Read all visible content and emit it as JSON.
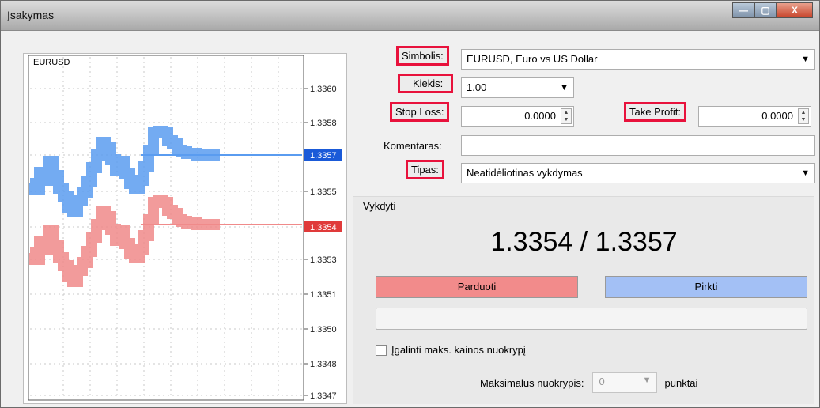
{
  "window": {
    "title": "Įsakymas",
    "buttons": {
      "minimize": "—",
      "maximize": "▢",
      "close": "X"
    }
  },
  "chart": {
    "symbol": "EURUSD",
    "price_ticks": [
      "1.3360",
      "1.3358",
      "1.3357",
      "1.3355",
      "1.3354",
      "1.3353",
      "1.3351",
      "1.3350",
      "1.3348",
      "1.3347"
    ],
    "ask_label": "1.3357",
    "bid_label": "1.3354",
    "colors": {
      "ask": "#5a9cf0",
      "bid": "#f08a8a",
      "ask_tag": "#1a5ad8",
      "bid_tag": "#e03a3a"
    }
  },
  "form": {
    "symbol_label": "Simbolis:",
    "symbol_value": "EURUSD, Euro vs US Dollar",
    "volume_label": "Kiekis:",
    "volume_value": "1.00",
    "stoploss_label": "Stop Loss:",
    "stoploss_value": "0.0000",
    "takeprofit_label": "Take Profit:",
    "takeprofit_value": "0.0000",
    "comment_label": "Komentaras:",
    "comment_value": "",
    "type_label": "Tipas:",
    "type_value": "Neatidėliotinas vykdymas"
  },
  "execution": {
    "group_title": "Vykdyti",
    "quote": "1.3354 / 1.3357",
    "sell_label": "Parduoti",
    "buy_label": "Pirkti",
    "deviation_check_label": "Įgalinti maks. kainos nuokrypį",
    "max_deviation_label": "Maksimalus nuokrypis:",
    "max_deviation_value": "0",
    "points_label": "punktai"
  },
  "colors": {
    "highlight": "#e8123c",
    "sell": "#f28b8b",
    "buy": "#a3c0f5"
  }
}
